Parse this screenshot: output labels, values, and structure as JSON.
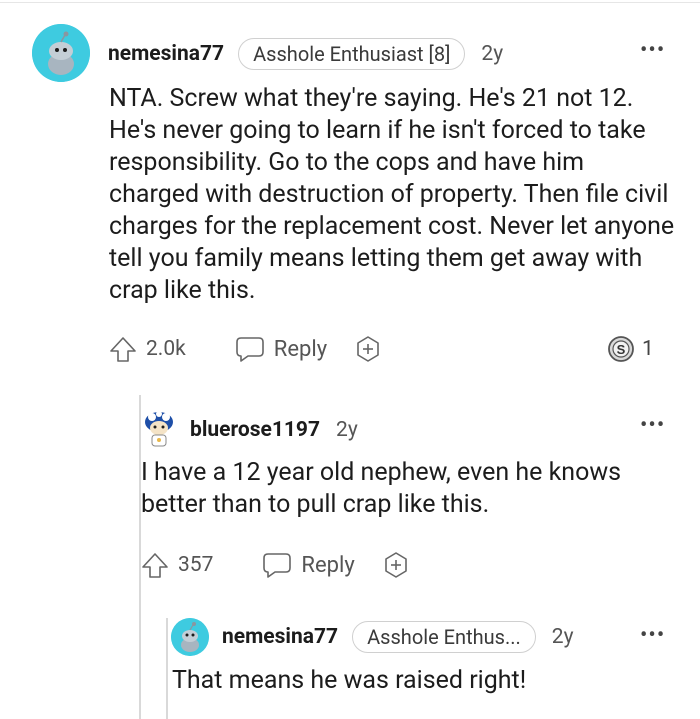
{
  "comments": [
    {
      "username": "nemesina77",
      "flair": "Asshole Enthusiast [8]",
      "age": "2y",
      "text": "NTA. Screw what they're saying. He's 21 not 12. He's never going to learn if he isn't forced to take responsibility. Go to the cops and have him charged with destruction of property. Then file civil charges for the replacement cost. Never let anyone tell you family means letting them get away with crap like this.",
      "upvotes": "2.0k",
      "reply_label": "Reply",
      "award_count": "1"
    },
    {
      "username": "bluerose1197",
      "age": "2y",
      "text": "I have a 12 year old nephew, even he knows better than to pull crap like this.",
      "upvotes": "357",
      "reply_label": "Reply"
    },
    {
      "username": "nemesina77",
      "flair": "Asshole Enthus...",
      "age": "2y",
      "text": "That means he was raised right!"
    }
  ],
  "colors": {
    "avatar_bg": "#3ecbe0",
    "text": "#1c1c1c",
    "muted": "#555555",
    "border": "#d0d0d0"
  },
  "icons": [
    "upvote-icon",
    "reply-bubble-icon",
    "award-plus-icon",
    "more-dots-icon",
    "silver-award-icon"
  ]
}
